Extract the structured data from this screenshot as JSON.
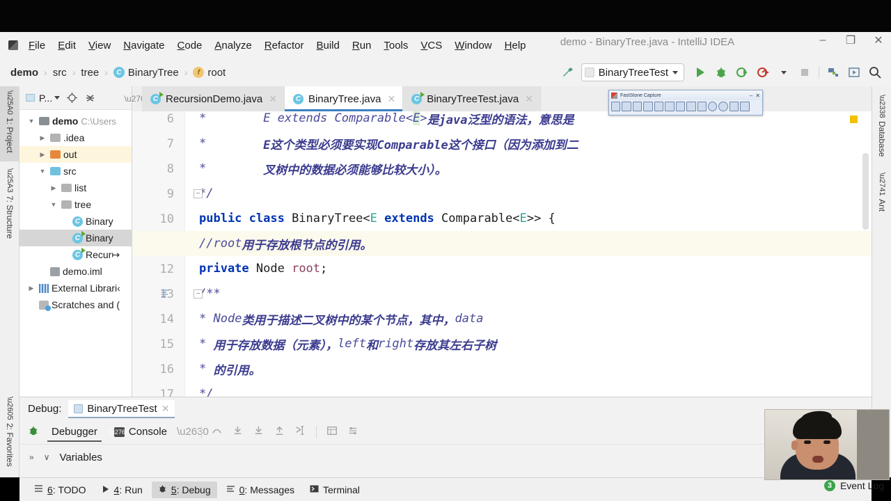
{
  "window": {
    "title": "demo - BinaryTree.java - IntelliJ IDEA",
    "minimize": "–",
    "maximize": "❐",
    "close": "✕"
  },
  "menu": {
    "items": [
      "File",
      "Edit",
      "View",
      "Navigate",
      "Code",
      "Analyze",
      "Refactor",
      "Build",
      "Run",
      "Tools",
      "VCS",
      "Window",
      "Help"
    ]
  },
  "breadcrumb": {
    "items": [
      {
        "label": "demo",
        "icon": "",
        "bold": true
      },
      {
        "label": "src",
        "icon": "",
        "bold": false
      },
      {
        "label": "tree",
        "icon": "",
        "bold": false
      },
      {
        "label": "BinaryTree",
        "icon": "class-icon",
        "glyph": "C",
        "bold": false
      },
      {
        "label": "root",
        "icon": "field-icon",
        "glyph": "f",
        "bold": false
      }
    ],
    "separator": "›"
  },
  "toolbar": {
    "build_icon": "hammer-icon",
    "run_config": "BinaryTreeTest",
    "run_icon": "run-icon",
    "debug_icon": "debug-icon",
    "run_coverage_icon": "run-with-coverage-icon",
    "profiler_icon": "profiler-icon",
    "stop_icon": "stop-icon",
    "project_structure_icon": "project-structure-icon",
    "update_icon": "update-icon",
    "search_icon": "search-icon"
  },
  "left_rail": {
    "tabs": [
      {
        "label": "1: Project",
        "icon": "project-icon",
        "selected": true
      },
      {
        "label": "7: Structure",
        "icon": "structure-icon",
        "selected": false
      },
      {
        "label": "2: Favorites",
        "icon": "star-icon",
        "selected": false
      }
    ]
  },
  "right_rail": {
    "tabs": [
      {
        "label": "Database",
        "icon": "database-icon"
      },
      {
        "label": "Ant",
        "icon": "ant-icon"
      }
    ]
  },
  "project_panel": {
    "header": {
      "title": "P...",
      "dropdown_icon": "chevron-down-icon",
      "locate_icon": "locate-target-icon",
      "collapse_icon": "collapse-all-icon"
    },
    "tree": [
      {
        "label": "demo",
        "path": "C:\\Users",
        "arrow": "▼",
        "icon": "module-folder",
        "indent": 0,
        "bold": true,
        "state": ""
      },
      {
        "label": ".idea",
        "path": "",
        "arrow": "▶",
        "icon": "folder-gray",
        "indent": 1,
        "bold": false,
        "state": ""
      },
      {
        "label": "out",
        "path": "",
        "arrow": "▶",
        "icon": "folder-orange",
        "indent": 1,
        "bold": false,
        "state": "hl"
      },
      {
        "label": "src",
        "path": "",
        "arrow": "▼",
        "icon": "folder-blue",
        "indent": 1,
        "bold": false,
        "state": ""
      },
      {
        "label": "list",
        "path": "",
        "arrow": "▶",
        "icon": "folder-gray",
        "indent": 2,
        "bold": false,
        "state": ""
      },
      {
        "label": "tree",
        "path": "",
        "arrow": "▼",
        "icon": "folder-gray",
        "indent": 2,
        "bold": false,
        "state": ""
      },
      {
        "label": "Binary",
        "path": "",
        "arrow": "",
        "icon": "java-class",
        "indent": 3,
        "bold": false,
        "state": ""
      },
      {
        "label": "Binary",
        "path": "",
        "arrow": "",
        "icon": "java-runnable",
        "indent": 3,
        "bold": false,
        "state": "sel"
      },
      {
        "label": "Recur↦",
        "path": "",
        "arrow": "",
        "icon": "java-runnable",
        "indent": 3,
        "bold": false,
        "state": ""
      },
      {
        "label": "demo.iml",
        "path": "",
        "arrow": "",
        "icon": "iml-file",
        "indent": 1,
        "bold": false,
        "state": ""
      },
      {
        "label": "External Librari‹",
        "path": "",
        "arrow": "▶",
        "icon": "library-icon",
        "indent": 0,
        "bold": false,
        "state": ""
      },
      {
        "label": "Scratches and (",
        "path": "",
        "arrow": "",
        "icon": "scratches-icon",
        "indent": 0,
        "bold": false,
        "state": ""
      }
    ]
  },
  "editor": {
    "pin_icon": "pin-icon",
    "tabs": [
      {
        "label": "RecursionDemo.java",
        "icon": "java-runnable",
        "active": false,
        "close": "✕"
      },
      {
        "label": "BinaryTree.java",
        "icon": "java-class",
        "active": true,
        "close": "✕"
      },
      {
        "label": "BinaryTreeTest.java",
        "icon": "java-runnable",
        "active": false,
        "close": "✕"
      }
    ],
    "lines": [
      {
        "num": "6",
        "highlight": false,
        "fold": "",
        "gutter": "",
        "html": "  <span class='cmt'>*        </span><span class='cmt'>E extends Comparable&lt;</span><span class='cmt hlword'>E</span><span class='cmt'>&gt;</span><span class='cmtb'>是java泛型的语法，意思是</span>"
      },
      {
        "num": "7",
        "highlight": false,
        "fold": "",
        "gutter": "",
        "html": "  <span class='cmt'>*        </span><span class='cmtb'>E这个类型必须要实现Comparable这个接口（因为添加到二</span>"
      },
      {
        "num": "8",
        "highlight": false,
        "fold": "",
        "gutter": "",
        "html": "  <span class='cmt'>*        </span><span class='cmtb'>叉树中的数据必须能够比较大小）。</span>"
      },
      {
        "num": "9",
        "highlight": false,
        "fold": "−",
        "gutter": "",
        "html": "  <span class='cmt'>*/</span>"
      },
      {
        "num": "10",
        "highlight": false,
        "fold": "",
        "gutter": "",
        "html": "<span class='kw'>public class </span><span class='typ'>BinaryTree&lt;</span><span class='gen'>E</span><span class='kw'> extends </span><span class='typ'>Comparable&lt;</span><span class='gen'>E</span><span class='typ'>&gt;&gt; {</span>"
      },
      {
        "num": "11",
        "highlight": true,
        "fold": "",
        "gutter": "",
        "html": "    <span class='cmt'>//root</span><span class='cmtb'>用于存放根节点的引用。</span>"
      },
      {
        "num": "12",
        "highlight": false,
        "fold": "",
        "gutter": "",
        "html": "    <span class='kw'>private </span><span class='typ'>Node </span><span class='fld2'>root</span><span class='typ'>;</span>"
      },
      {
        "num": "13",
        "highlight": false,
        "fold": "−",
        "gutter": "doc-icon",
        "html": "    <span class='cmt'>/**</span>"
      },
      {
        "num": "14",
        "highlight": false,
        "fold": "",
        "gutter": "",
        "html": "     <span class='cmt'>* </span><span class='cmt'>Node</span><span class='cmtb'>类用于描述二叉树中的某个节点，其中，</span><span class='cmt'>data</span>"
      },
      {
        "num": "15",
        "highlight": false,
        "fold": "",
        "gutter": "",
        "html": "     <span class='cmt'>* </span><span class='cmtb'>用于存放数据（元素），</span><span class='cmt'>left</span><span class='cmtb'>和</span><span class='cmt'>right</span><span class='cmtb'>存放其左右子树</span>"
      },
      {
        "num": "16",
        "highlight": false,
        "fold": "",
        "gutter": "",
        "html": "     <span class='cmt'>* </span><span class='cmtb'>的引用。</span>"
      },
      {
        "num": "17",
        "highlight": false,
        "fold": "",
        "gutter": "",
        "html": "     <span class='cmt'>*/</span>"
      }
    ],
    "warning_marker_color": "#f2c200"
  },
  "faststone": {
    "title": "FastStone Capture",
    "minimize": "–",
    "close": "✕",
    "tools": [
      "open-icon",
      "capture-window-icon",
      "capture-object-icon",
      "capture-rect-icon",
      "capture-freehand-icon",
      "capture-fullscreen-icon",
      "capture-scroll-icon",
      "capture-fixed-icon",
      "screen-recorder-icon",
      "magnifier-icon",
      "timer-icon",
      "settings-icon",
      "dropdown-icon",
      "send-to-icon"
    ]
  },
  "debug_panel": {
    "label": "Debug:",
    "session_tab": "BinaryTreeTest",
    "session_close": "✕",
    "bug_icon": "debug-bug-icon",
    "tabs": [
      {
        "label": "Debugger",
        "icon": "",
        "selected": true
      },
      {
        "label": "Console",
        "icon": "console-icon",
        "selected": false
      }
    ],
    "layout_icon": "layout-settings-icon",
    "step_icons": [
      "step-over-icon",
      "step-into-icon",
      "force-step-into-icon",
      "step-out-icon",
      "run-to-cursor-icon",
      "evaluate-icon",
      "mute-breakpoints-icon"
    ],
    "expand_icon": "»",
    "collapse_icon": "∨",
    "variables_label": "Variables"
  },
  "status_bar": {
    "items": [
      {
        "label": "6: TODO",
        "icon": "todo-icon",
        "selected": false
      },
      {
        "label": "4: Run",
        "icon": "run-icon",
        "selected": false
      },
      {
        "label": "5: Debug",
        "icon": "debug-icon",
        "selected": true
      },
      {
        "label": "0: Messages",
        "icon": "messages-icon",
        "selected": false
      },
      {
        "label": "Terminal",
        "icon": "terminal-icon",
        "selected": false
      }
    ],
    "event_log": {
      "label": "Event Log",
      "count": "3",
      "badge_color": "#3aa34a"
    }
  },
  "webcam": {
    "alt": "presenter-webcam-overlay"
  }
}
